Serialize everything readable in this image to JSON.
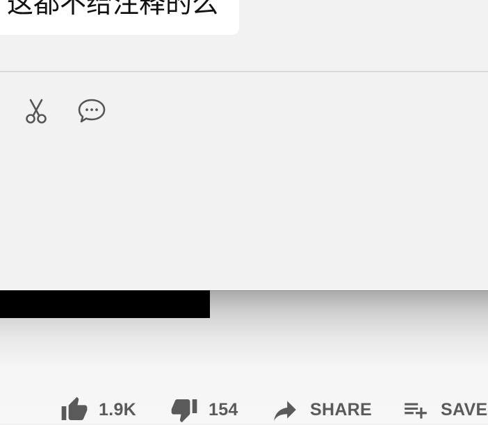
{
  "comment": {
    "text": "这都不给注释的么"
  },
  "tools": {
    "clip_icon": "scissors-icon",
    "comment_icon": "chat-bubble-icon"
  },
  "actions": {
    "like": {
      "icon": "thumbs-up-icon",
      "label": "1.9K"
    },
    "dislike": {
      "icon": "thumbs-down-icon",
      "label": "154"
    },
    "share": {
      "icon": "share-arrow-icon",
      "label": "SHARE"
    },
    "save": {
      "icon": "playlist-add-icon",
      "label": "SAVE"
    }
  },
  "colors": {
    "background": "#f2f2f2",
    "icon": "#5a5a5a",
    "bubble": "#ffffff"
  }
}
